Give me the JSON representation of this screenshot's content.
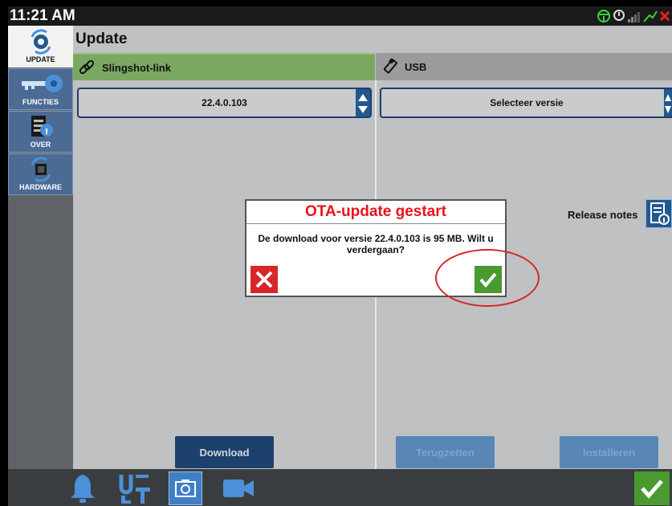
{
  "status_bar": {
    "time": "11:21 AM",
    "icons": [
      "steering-wheel-icon",
      "gps-status-icon",
      "signal-strength-icon",
      "warning-icon",
      "close-icon"
    ]
  },
  "sidebar": {
    "items": [
      {
        "label": "UPDATE",
        "icon": "update-gear-icon",
        "active": true
      },
      {
        "label": "FUNCTIES",
        "icon": "key-icon",
        "active": false
      },
      {
        "label": "OVER",
        "icon": "document-icon",
        "active": false
      },
      {
        "label": "HARDWARE",
        "icon": "chip-icon",
        "active": false
      }
    ]
  },
  "main": {
    "title": "Update",
    "left_column": {
      "header": "Slingshot-link",
      "icon": "link-icon",
      "selected_version": "22.4.0.103",
      "download_label": "Download"
    },
    "right_column": {
      "header": "USB",
      "icon": "usb-icon",
      "select_placeholder": "Selecteer versie",
      "release_notes_label": "Release notes",
      "restore_label": "Terugzetten",
      "install_label": "Installeren"
    }
  },
  "dialog": {
    "title": "OTA-update gestart",
    "message": "De download voor versie 22.4.0.103 is 95 MB. Wilt u verdergaan?"
  },
  "bottom_bar": {
    "icons": [
      "bell-icon",
      "ut-icon",
      "camera-icon",
      "video-icon",
      "checkmark-icon"
    ]
  },
  "colors": {
    "accent_green": "#7aa861",
    "button_blue": "#1b416c",
    "alert_red": "#e8141c",
    "confirm_green": "#4a9a2f"
  }
}
